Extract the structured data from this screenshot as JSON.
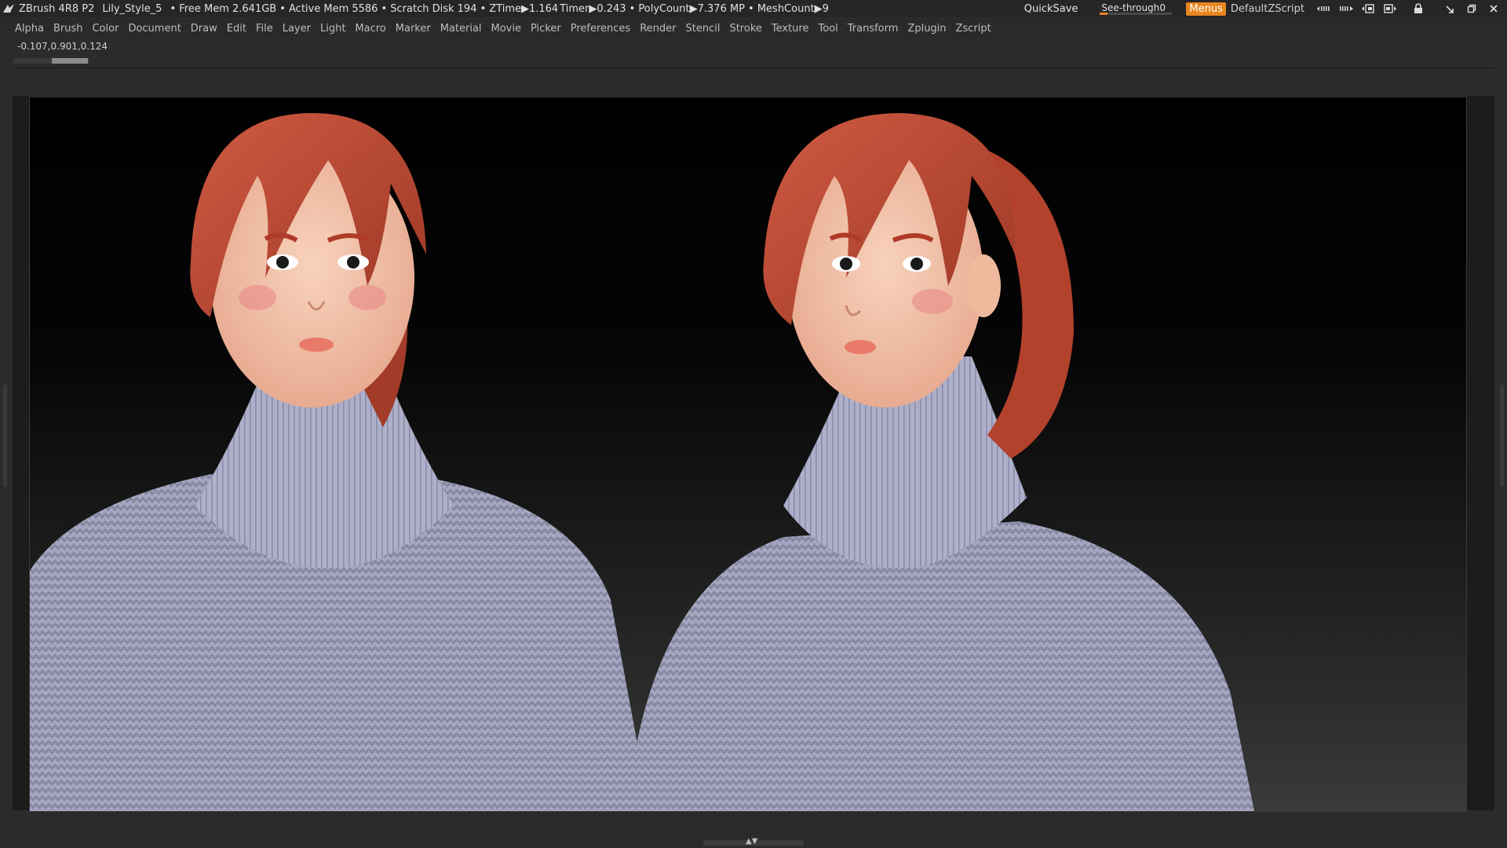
{
  "titlebar": {
    "app": "ZBrush 4R8 P2",
    "project": "Lily_Style_5",
    "free_mem": "• Free Mem 2.641GB",
    "active_mem": "• Active Mem 5586",
    "scratch_disk": "• Scratch Disk 194 •",
    "ztime": "ZTime▶1.164",
    "timer": "Timer▶0.243",
    "polycount": "• PolyCount▶7.376 MP",
    "meshcount": "• MeshCount▶9",
    "quicksave": "QuickSave",
    "see_through_label": "See-through",
    "see_through_value": "0",
    "see_through_level": 0.0,
    "menus": "Menus",
    "script": "DefaultZScript"
  },
  "menu": [
    "Alpha",
    "Brush",
    "Color",
    "Document",
    "Draw",
    "Edit",
    "File",
    "Layer",
    "Light",
    "Macro",
    "Marker",
    "Material",
    "Movie",
    "Picker",
    "Preferences",
    "Render",
    "Stencil",
    "Stroke",
    "Texture",
    "Tool",
    "Transform",
    "Zplugin",
    "Zscript"
  ],
  "status": {
    "coords": "-0.107,0.901,0.124"
  },
  "colors": {
    "accent": "#e8861e",
    "hair": "#b8452f",
    "skin": "#f3c2a8",
    "sweater": "#9a9cb8"
  }
}
